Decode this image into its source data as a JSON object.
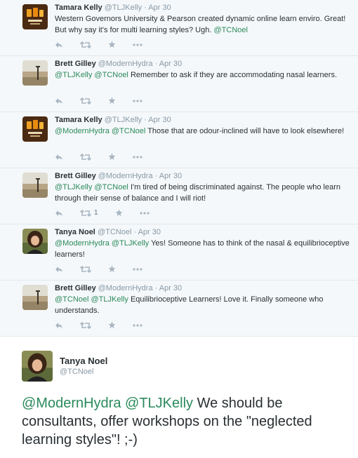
{
  "thread": [
    {
      "name": "Tamara Kelly",
      "handle": "@TLJKelly",
      "time": "Apr 30",
      "avatar": "logo-avatar",
      "mentions": [],
      "text": "Western Governors University & Pearson created dynamic online learn enviro. Great! But why say it's for multi learning styles? Ugh.",
      "trailing_mention": "@TCNoel",
      "retweet_count": ""
    },
    {
      "name": "Brett Gilley",
      "handle": "@ModernHydra",
      "time": "Apr 30",
      "avatar": "landscape-avatar",
      "mentions": [
        "@TLJKelly",
        "@TCNoel"
      ],
      "text": "Remember to ask if they are accommodating nasal learners.",
      "trailing_mention": "",
      "retweet_count": ""
    },
    {
      "name": "Tamara Kelly",
      "handle": "@TLJKelly",
      "time": "Apr 30",
      "avatar": "logo-avatar",
      "mentions": [
        "@ModernHydra",
        "@TCNoel"
      ],
      "text": "Those that are odour-inclined will have to look elsewhere!",
      "trailing_mention": "",
      "retweet_count": ""
    },
    {
      "name": "Brett Gilley",
      "handle": "@ModernHydra",
      "time": "Apr 30",
      "avatar": "landscape-avatar",
      "mentions": [
        "@TLJKelly",
        "@TCNoel"
      ],
      "text": "I'm tired of being discriminated against. The people who learn through their sense of balance and I will riot!",
      "trailing_mention": "",
      "retweet_count": "1"
    },
    {
      "name": "Tanya Noel",
      "handle": "@TCNoel",
      "time": "Apr 30",
      "avatar": "portrait-avatar",
      "mentions": [
        "@ModernHydra",
        "@TLJKelly"
      ],
      "text": "Yes! Someone has to think of the nasal & equilibrioceptive learners!",
      "trailing_mention": "",
      "retweet_count": ""
    },
    {
      "name": "Brett Gilley",
      "handle": "@ModernHydra",
      "time": "Apr 30",
      "avatar": "landscape-avatar",
      "mentions": [
        "@TCNoel",
        "@TLJKelly"
      ],
      "text": " Equilibrioceptive Learners! Love it. Finally someone who understands.",
      "trailing_mention": "",
      "retweet_count": ""
    }
  ],
  "main_tweet": {
    "name": "Tanya Noel",
    "handle": "@TCNoel",
    "avatar": "portrait-avatar",
    "mentions": [
      "@ModernHydra",
      "@TLJKelly"
    ],
    "text": "We should be consultants, offer workshops on the \"neglected learning styles\"! ;-)"
  },
  "separator": "·",
  "icons": [
    "reply-icon",
    "retweet-icon",
    "favorite-icon",
    "more-icon"
  ],
  "colors": {
    "mention": "#2a8a5c",
    "muted": "#8899a6",
    "icon": "#a8b6c2",
    "thread_bg": "#f5f8fa"
  }
}
